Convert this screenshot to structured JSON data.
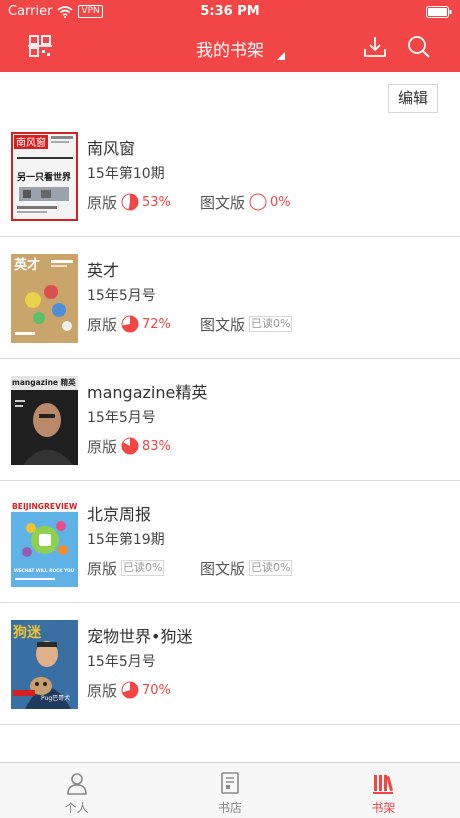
{
  "status_bar": {
    "carrier": "Carrier",
    "vpn": "VPN",
    "time": "5:36 PM"
  },
  "nav": {
    "title": "我的书架"
  },
  "edit_label": "编辑",
  "colors": {
    "accent": "#f24545",
    "progress_bg": "#ffffff"
  },
  "items": [
    {
      "title": "南风窗",
      "issue": "15年第10期",
      "original": {
        "label": "原版",
        "progress": 53,
        "text": "53%"
      },
      "graphic": {
        "label": "图文版",
        "progress": 0,
        "text": "0%"
      },
      "cover": {
        "masthead": "南风窗",
        "headline": "另一只看世界",
        "bg": "#ffffff",
        "accent": "#d32020"
      }
    },
    {
      "title": "英才",
      "issue": "15年5月号",
      "original": {
        "label": "原版",
        "progress": 72,
        "text": "72%"
      },
      "graphic": {
        "label": "图文版",
        "tag": "已读0%"
      },
      "cover": {
        "masthead": "英才",
        "bg": "#c9a46b",
        "accent": "#ffffff"
      }
    },
    {
      "title": "mangazine精英",
      "issue": "15年5月号",
      "original": {
        "label": "原版",
        "progress": 83,
        "text": "83%"
      },
      "cover": {
        "masthead": "mangazine 精英",
        "bg": "#dcdcdc",
        "accent": "#222222"
      }
    },
    {
      "title": "北京周报",
      "issue": "15年第19期",
      "original": {
        "label": "原版",
        "tag": "已读0%"
      },
      "graphic": {
        "label": "图文版",
        "tag": "已读0%"
      },
      "cover": {
        "masthead": "BEIJINGREVIEW",
        "headline": "WECHAT WILL ROCK YOU",
        "bg": "#5eb2e6",
        "accent": "#d42020"
      }
    },
    {
      "title": "宠物世界•狗迷",
      "issue": "15年5月号",
      "original": {
        "label": "原版",
        "progress": 70,
        "text": "70%"
      },
      "cover": {
        "masthead": "狗迷",
        "headline": "Pug巴哥犬",
        "bg": "#3a6fa3",
        "accent": "#f2c230"
      }
    }
  ],
  "tabs": [
    {
      "label": "个人",
      "icon": "person-icon",
      "active": false
    },
    {
      "label": "书店",
      "icon": "store-icon",
      "active": false
    },
    {
      "label": "书架",
      "icon": "bookshelf-icon",
      "active": true
    }
  ]
}
